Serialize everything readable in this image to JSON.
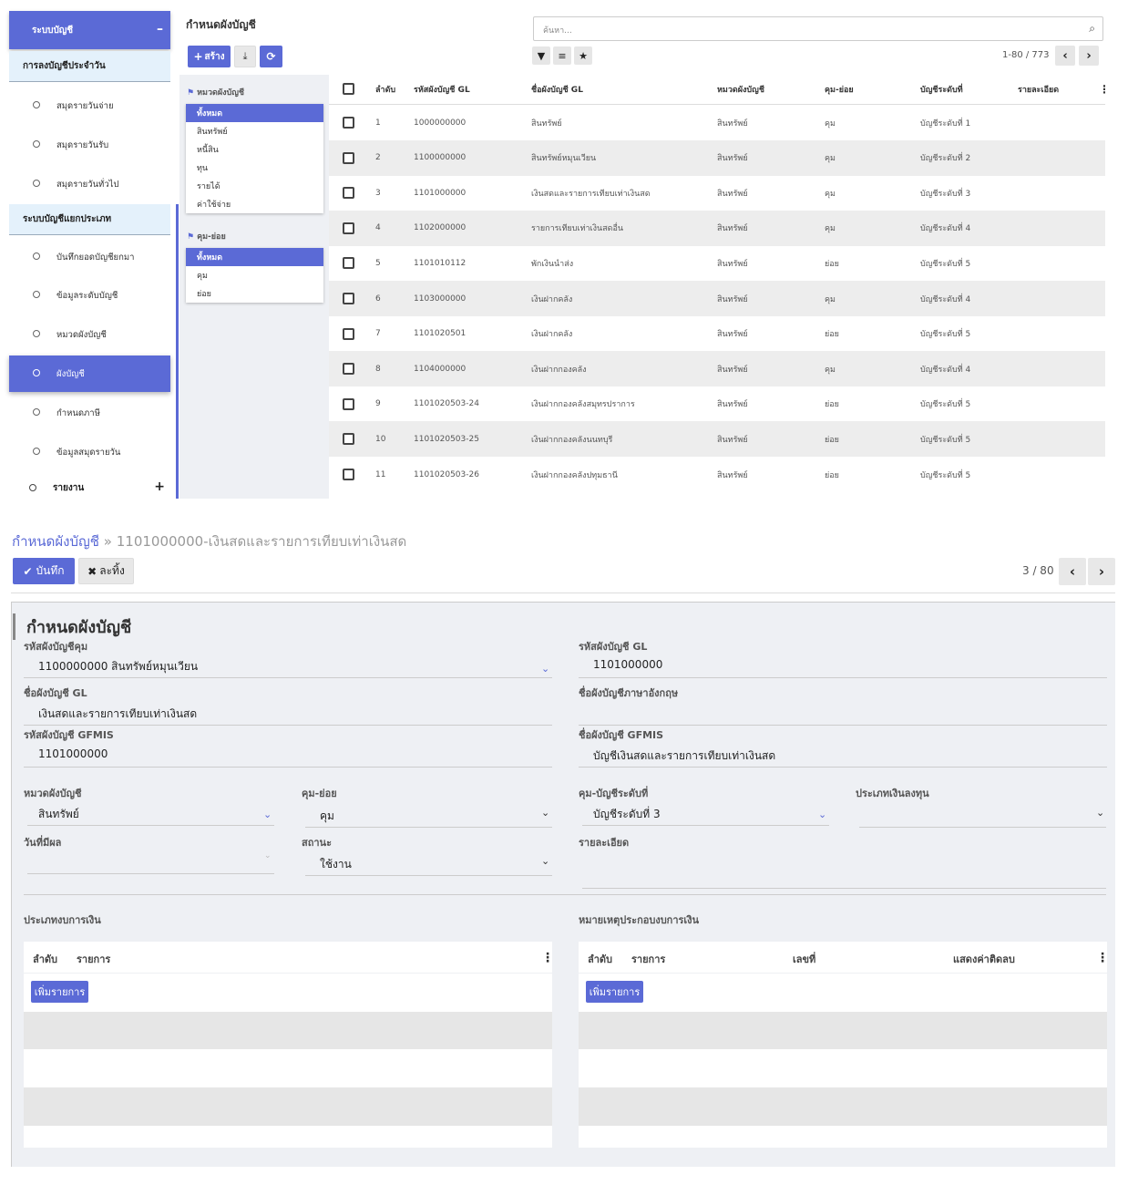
{
  "sidebar": {
    "header": "ระบบบัญชี",
    "collapse_symbol": "–",
    "section1": "การลงบัญชีประจำวัน",
    "section1_items": [
      "สมุดรายวันจ่าย",
      "สมุดรายวันรับ",
      "สมุดรายวันทั่วไป"
    ],
    "section2": "ระบบบัญชีแยกประเภท",
    "section2_items": [
      "บันทึกยอดบัญชียกมา",
      "ข้อมูลระดับบัญชี",
      "หมวดผังบัญชี",
      "ผังบัญชี",
      "กำหนดภาษี",
      "ข้อมูลสมุดรายวัน"
    ],
    "active_item": "ผังบัญชี",
    "report": "รายงาน"
  },
  "list": {
    "title": "กำหนดผังบัญชี",
    "create_label": "สร้าง",
    "search_placeholder": "ค้นหา...",
    "pager": "1-80 / 773",
    "filters": {
      "group1_title": "หมวดผังบัญชี",
      "group1_options": [
        "ทั้งหมด",
        "สินทรัพย์",
        "หนี้สิน",
        "ทุน",
        "รายได้",
        "ค่าใช้จ่าย"
      ],
      "group2_title": "คุม-ย่อย",
      "group2_options": [
        "ทั้งหมด",
        "คุม",
        "ย่อย"
      ]
    },
    "columns": [
      "ลำดับ",
      "รหัสผังบัญชี GL",
      "ชื่อผังบัญชี GL",
      "หมวดผังบัญชี",
      "คุม-ย่อย",
      "บัญชีระดับที่",
      "รายละเอียด"
    ],
    "rows": [
      [
        "1",
        "1000000000",
        "สินทรัพย์",
        "สินทรัพย์",
        "คุม",
        "บัญชีระดับที่ 1"
      ],
      [
        "2",
        "1100000000",
        "สินทรัพย์หมุนเวียน",
        "สินทรัพย์",
        "คุม",
        "บัญชีระดับที่ 2"
      ],
      [
        "3",
        "1101000000",
        "เงินสดและรายการเทียบเท่าเงินสด",
        "สินทรัพย์",
        "คุม",
        "บัญชีระดับที่ 3"
      ],
      [
        "4",
        "1102000000",
        "รายการเทียบเท่าเงินสดอื่น",
        "สินทรัพย์",
        "คุม",
        "บัญชีระดับที่ 4"
      ],
      [
        "5",
        "1101010112",
        "พักเงินนำส่ง",
        "สินทรัพย์",
        "ย่อย",
        "บัญชีระดับที่ 5"
      ],
      [
        "6",
        "1103000000",
        "เงินฝากคลัง",
        "สินทรัพย์",
        "คุม",
        "บัญชีระดับที่ 4"
      ],
      [
        "7",
        "1101020501",
        "เงินฝากคลัง",
        "สินทรัพย์",
        "ย่อย",
        "บัญชีระดับที่ 5"
      ],
      [
        "8",
        "1104000000",
        "เงินฝากกองคลัง",
        "สินทรัพย์",
        "คุม",
        "บัญชีระดับที่ 4"
      ],
      [
        "9",
        "1101020503-24",
        "เงินฝากกองคลังสมุทรปราการ",
        "สินทรัพย์",
        "ย่อย",
        "บัญชีระดับที่ 5"
      ],
      [
        "10",
        "1101020503-25",
        "เงินฝากกองคลังนนทบุรี",
        "สินทรัพย์",
        "ย่อย",
        "บัญชีระดับที่ 5"
      ],
      [
        "11",
        "1101020503-26",
        "เงินฝากกองคลังปทุมธานี",
        "สินทรัพย์",
        "ย่อย",
        "บัญชีระดับที่ 5"
      ]
    ]
  },
  "form": {
    "breadcrumb_parent": "กำหนดผังบัญชี",
    "breadcrumb_sep": "»",
    "breadcrumb_record": "1101000000-เงินสดและรายการเทียบเท่าเงินสด",
    "save_label": "บันทึก",
    "discard_label": "ละทิ้ง",
    "pager": "3 / 80",
    "sheet_title": "กำหนดผังบัญชี",
    "fields": {
      "parent_code_label": "รหัสผังบัญชีคุม",
      "parent_code_value": "1100000000 สินทรัพย์หมุนเวียน",
      "gl_code_label": "รหัสผังบัญชี GL",
      "gl_code_value": "1101000000",
      "gl_name_label": "ชื่อผังบัญชี GL",
      "gl_name_value": "เงินสดและรายการเทียบเท่าเงินสด",
      "en_name_label": "ชื่อผังบัญชีภาษาอังกฤษ",
      "gfmis_code_label": "รหัสผังบัญชี GFMIS",
      "gfmis_code_value": "1101000000",
      "gfmis_name_label": "ชื่อผังบัญชี GFMIS",
      "gfmis_name_value": "บัญชีเงินสดและรายการเทียบเท่าเงินสด",
      "category_label": "หมวดผังบัญชี",
      "category_value": "สินทรัพย์",
      "control_label": "คุม-ย่อย",
      "control_value": "คุม",
      "level_label": "คุม-บัญชีระดับที่",
      "level_value": "บัญชีระดับที่ 3",
      "invest_label": "ประเภทเงินลงทุน",
      "effective_label": "วันที่มีผล",
      "status_label": "สถานะ",
      "status_value": "ใช้งาน",
      "detail_label": "รายละเอียด"
    },
    "fs_type_title": "ประเภทงบการเงิน",
    "fs_note_title": "หมายเหตุประกอบงบการเงิน",
    "sub_col_seq": "ลำดับ",
    "sub_col_item": "รายการ",
    "sub_col_number": "เลขที่",
    "sub_col_negative": "แสดงค่าติดลบ",
    "add_item_label": "เพิ่มรายการ"
  }
}
